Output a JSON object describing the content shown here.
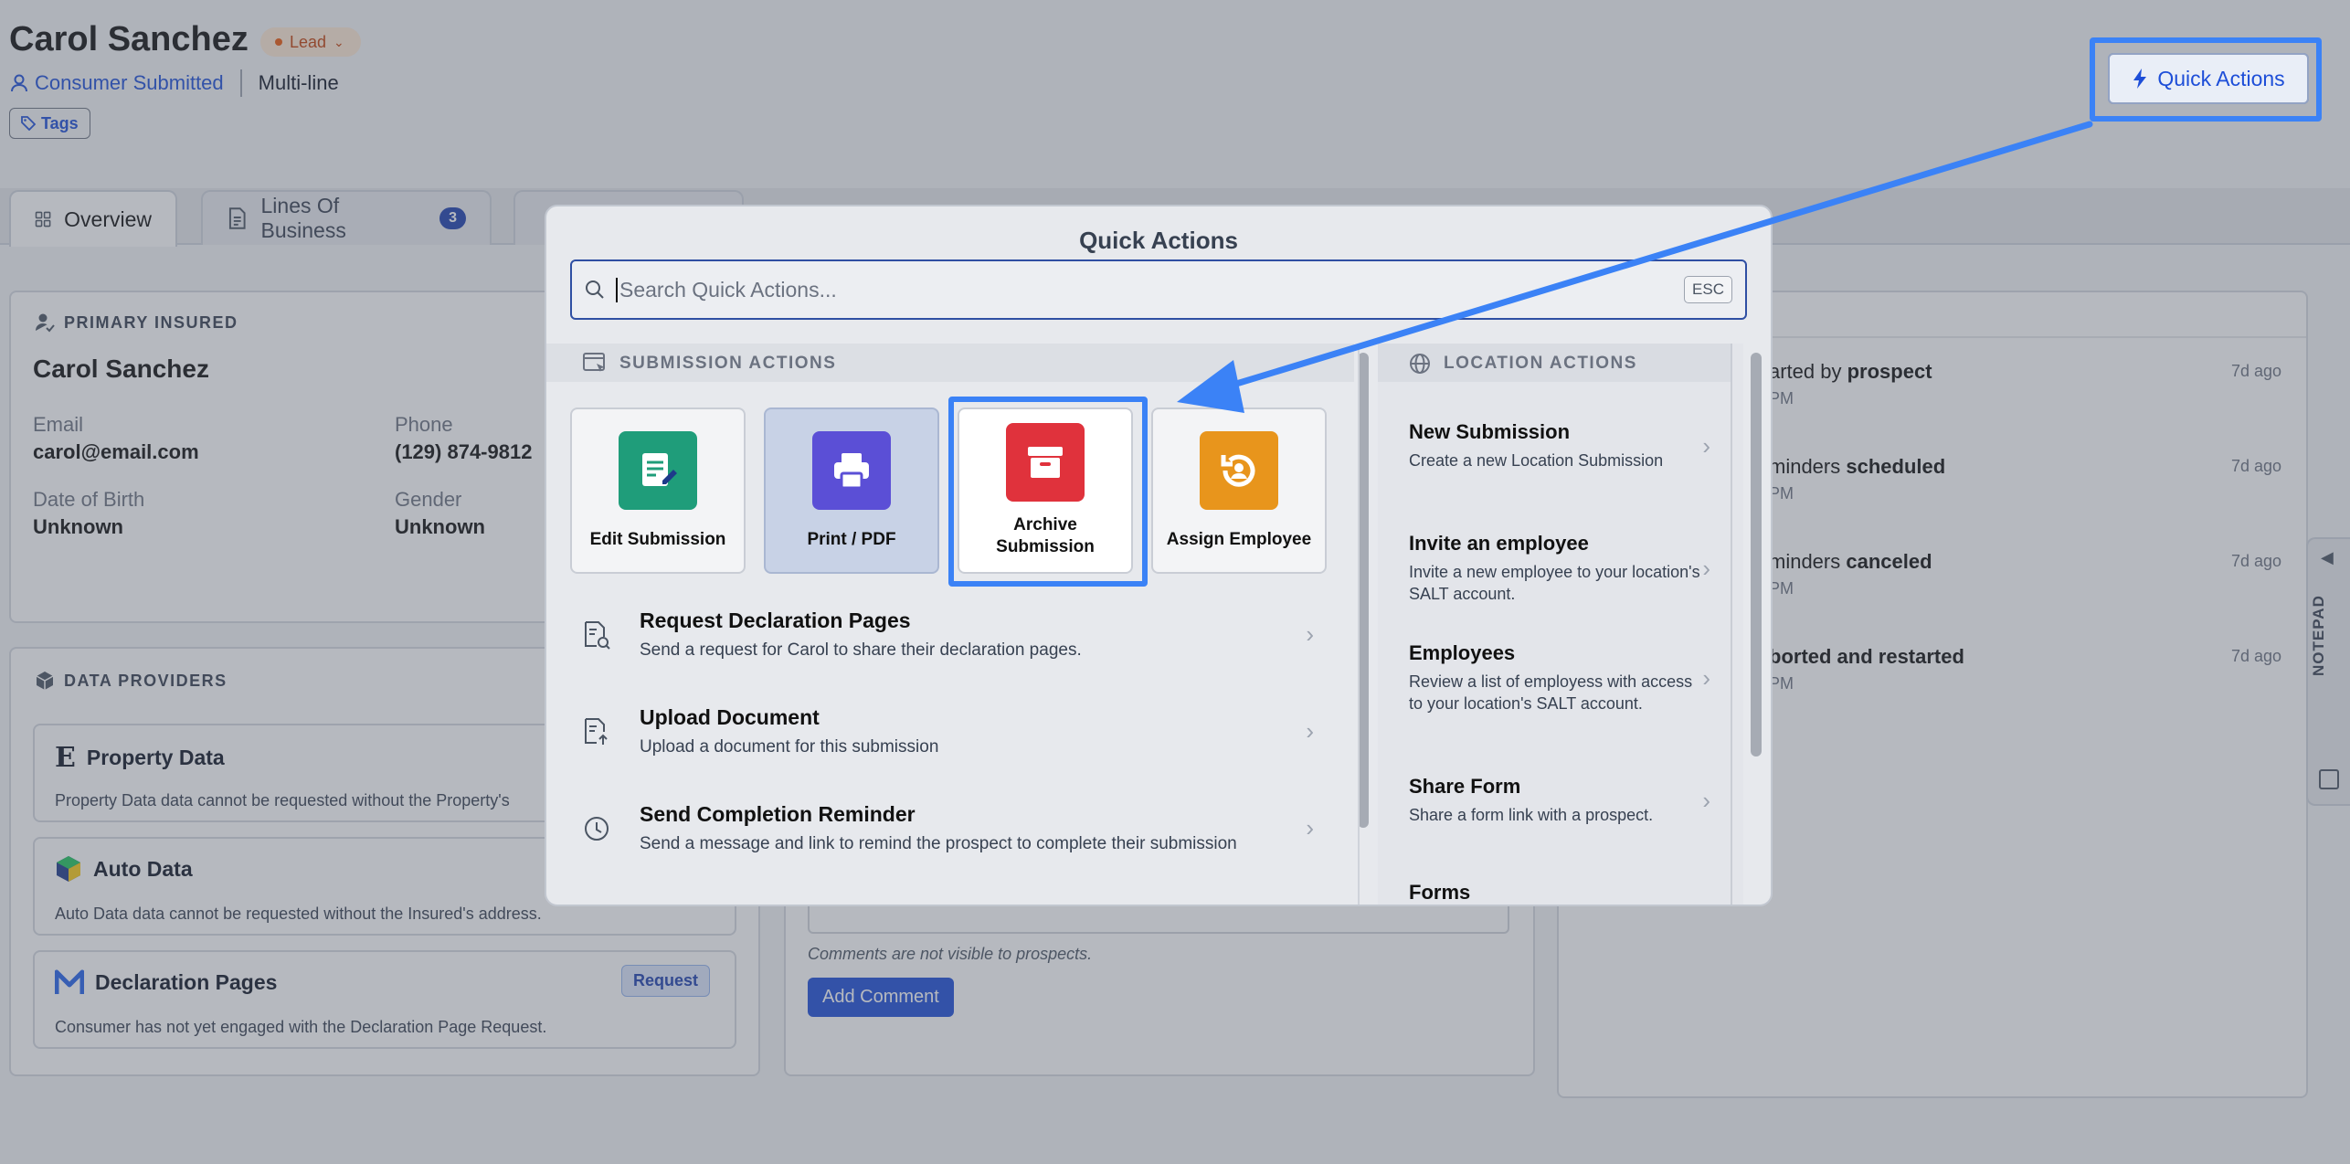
{
  "header": {
    "title": "Carol Sanchez",
    "status_badge": "Lead",
    "source_link": "Consumer Submitted",
    "policy_type": "Multi-line",
    "tags_label": "Tags",
    "quick_actions_label": "Quick Actions"
  },
  "tabs": [
    {
      "label": "Overview"
    },
    {
      "label": "Lines Of Business",
      "count": "3"
    }
  ],
  "primary_insured": {
    "heading": "PRIMARY INSURED",
    "name": "Carol Sanchez",
    "email_label": "Email",
    "email": "carol@email.com",
    "phone_label": "Phone",
    "phone": "(129) 874-9812",
    "dob_label": "Date of Birth",
    "dob": "Unknown",
    "gender_label": "Gender",
    "gender": "Unknown"
  },
  "data_providers": {
    "heading": "DATA PROVIDERS",
    "items": [
      {
        "name": "Property Data",
        "desc": "Property Data data cannot be requested without the Property's"
      },
      {
        "name": "Auto Data",
        "desc": "Auto Data data cannot be requested without the Insured's address."
      },
      {
        "name": "Declaration Pages",
        "desc": "Consumer has not yet engaged with the Declaration Page Request.",
        "action": "Request"
      }
    ]
  },
  "comments": {
    "note": "Comments are not visible to prospects.",
    "add_label": "Add Comment"
  },
  "activity": [
    {
      "prefix": "arted by ",
      "bold": "prospect",
      "sub": "PM",
      "time": "7d ago"
    },
    {
      "prefix": "minders ",
      "bold": "scheduled",
      "sub": "PM",
      "time": "7d ago"
    },
    {
      "prefix": "minders ",
      "bold": "canceled",
      "sub": "PM",
      "time": "7d ago"
    },
    {
      "prefix": "",
      "bold": "borted and restarted",
      "sub": "PM",
      "time": "7d ago"
    }
  ],
  "notepad_label": "NOTEPAD",
  "modal": {
    "title": "Quick Actions",
    "search_placeholder": "Search Quick Actions...",
    "esc_label": "ESC",
    "submission_heading": "SUBMISSION ACTIONS",
    "location_heading": "LOCATION ACTIONS",
    "tiles": [
      {
        "label": "Edit Submission",
        "icon": "edit-document-icon",
        "color": "#1f9d7a"
      },
      {
        "label": "Print / PDF",
        "icon": "printer-icon",
        "color": "#5b4fd6"
      },
      {
        "label": "Archive Submission",
        "icon": "archive-box-icon",
        "color": "#e0323c"
      },
      {
        "label": "Assign Employee",
        "icon": "user-rotate-icon",
        "color": "#e8951c"
      }
    ],
    "submission_actions": [
      {
        "title": "Request Declaration Pages",
        "desc": "Send a request for Carol to share their declaration pages."
      },
      {
        "title": "Upload Document",
        "desc": "Upload a document for this submission"
      },
      {
        "title": "Send Completion Reminder",
        "desc": "Send a message and link to remind the prospect to complete their submission"
      }
    ],
    "location_actions": [
      {
        "title": "New Submission",
        "desc": "Create a new Location Submission"
      },
      {
        "title": "Invite an employee",
        "desc": "Invite a new employee to your location's SALT account."
      },
      {
        "title": "Employees",
        "desc": "Review a list of employess with access to your location's SALT account."
      },
      {
        "title": "Share Form",
        "desc": "Share a form link with a prospect."
      },
      {
        "title": "Forms",
        "desc": ""
      }
    ]
  }
}
